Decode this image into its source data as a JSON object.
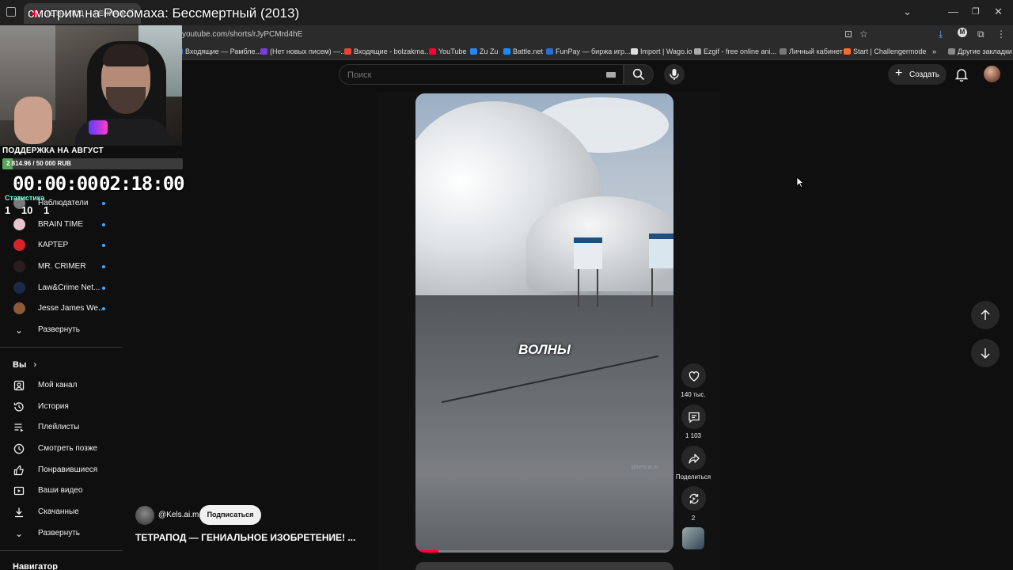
{
  "browser": {
    "tab_title": "ТЕТРАПОД — ГЕНИАЛЬ...",
    "url": "youtube.com/shorts/rJyPCMrd4hE",
    "bookmarks": [
      {
        "label": "Входящие — Рамбле...",
        "color": "#3a6cd6"
      },
      {
        "label": "(Нет новых писем) —...",
        "color": "#7a3fd6"
      },
      {
        "label": "Входящие - bolzakma...",
        "color": "#ea4335"
      },
      {
        "label": "YouTube",
        "color": "#ff0033"
      },
      {
        "label": "Zu Zu",
        "color": "#2787f5"
      },
      {
        "label": "Battle.net",
        "color": "#148eff"
      },
      {
        "label": "FunPay — биржа игр...",
        "color": "#2a6cd6"
      },
      {
        "label": "Import | Wago.io",
        "color": "#dddddd"
      },
      {
        "label": "Ezgif - free online ani...",
        "color": "#aaaaaa"
      },
      {
        "label": "Личный кабинет",
        "color": "#777777"
      },
      {
        "label": "Start | Challengermode",
        "color": "#ff6a2a"
      },
      {
        "label": "Другие закладки",
        "color": "#888888"
      }
    ]
  },
  "overlay": {
    "stream_title": "смотрим на Росомаха: Бессмертный (2013)",
    "support_title": "ПОДДЕРЖКА НА АВГУСТ",
    "support_amount": "2 814.96 / 50 000 RUB",
    "support_progress": 0.056,
    "timer_elapsed": "00:00:00",
    "timer_total": "02:18:00",
    "stats_label": "Статистика",
    "stats_values": [
      "1",
      "10",
      "1"
    ]
  },
  "sidebar": {
    "subscriptions": [
      {
        "label": "Наблюдатели",
        "avatar_color": "#7a7a7a"
      },
      {
        "label": "BRAIN TIME",
        "avatar_color": "#e8c6cf"
      },
      {
        "label": "КАРТЕР",
        "avatar_color": "#d8232a"
      },
      {
        "label": "MR. CRIMER",
        "avatar_color": "#2b1d1d"
      },
      {
        "label": "Law&Crime Net...",
        "avatar_color": "#1b2a4a"
      },
      {
        "label": "Jesse James We...",
        "avatar_color": "#8a5a3a"
      }
    ],
    "expand_label": "Развернуть",
    "you_heading": "Вы",
    "you_items": [
      {
        "label": "Мой канал",
        "icon": "my-channel-icon"
      },
      {
        "label": "История",
        "icon": "history-icon"
      },
      {
        "label": "Плейлисты",
        "icon": "playlists-icon"
      },
      {
        "label": "Смотреть позже",
        "icon": "watch-later-icon"
      },
      {
        "label": "Понравившиеся",
        "icon": "liked-icon"
      },
      {
        "label": "Ваши видео",
        "icon": "your-videos-icon"
      },
      {
        "label": "Скачанные",
        "icon": "downloads-icon"
      }
    ],
    "expand_label_2": "Развернуть",
    "navigator_heading": "Навигатор"
  },
  "masthead": {
    "search_placeholder": "Поиск",
    "create_label": "Создать"
  },
  "short": {
    "caption": "ВОЛНЫ",
    "watermark": "@kels.ai.m",
    "channel": "@Kels.ai.m",
    "subscribe_label": "Подписаться",
    "title": "ТЕТРАПОД — ГЕНИАЛЬНОЕ ИЗОБРЕТЕНИЕ! ...",
    "progress": 0.09,
    "likes": "140 тыс.",
    "comments": "1 103",
    "share_label": "Поделиться",
    "remix_count": "2"
  }
}
